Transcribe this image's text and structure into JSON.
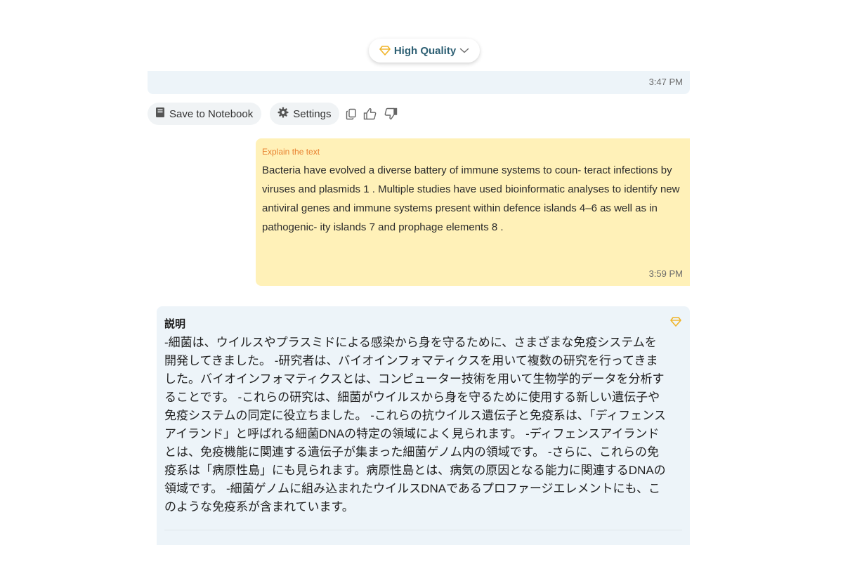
{
  "quality_selector": {
    "label": "High Quality"
  },
  "previous_message": {
    "time": "3:47 PM"
  },
  "actions": {
    "save_label": "Save to Notebook",
    "settings_label": "Settings"
  },
  "user_message": {
    "label": "Explain the text",
    "text": "Bacteria have evolved a diverse battery of immune systems to coun- teract infections by viruses and plasmids 1 . Multiple studies have used bioinformatic analyses to identify new antiviral genes and immune systems present within defence islands 4–6 as well as in pathogenic- ity islands 7 and prophage elements 8 .",
    "time": "3:59 PM"
  },
  "answer": {
    "title": "説明",
    "text": "-細菌は、ウイルスやプラスミドによる感染から身を守るために、さまざまな免疫システムを開発してきました。 -研究者は、バイオインフォマティクスを用いて複数の研究を行ってきました。バイオインフォマティクスとは、コンピューター技術を用いて生物学的データを分析することです。 -これらの研究は、細菌がウイルスから身を守るために使用する新しい遺伝子や免疫システムの同定に役立ちました。 -これらの抗ウイルス遺伝子と免疫系は、「ディフェンスアイランド」と呼ばれる細菌DNAの特定の領域によく見られます。 -ディフェンスアイランドとは、免疫機能に関連する遺伝子が集まった細菌ゲノム内の領域です。 -さらに、これらの免疫系は「病原性島」にも見られます。病原性島とは、病気の原因となる能力に関連するDNAの領域です。 -細菌ゲノムに組み込まれたウイルスDNAであるプロファージエレメントにも、このような免疫系が含まれています。"
  },
  "colors": {
    "gem": "#f0b429",
    "message_bg": "#edf4f9",
    "user_bg": "#fff1b8",
    "label_orange": "#e8812f",
    "pill_text": "#2d5f73"
  },
  "icons": {
    "quality": "diamond-icon",
    "chevron": "chevron-down-icon",
    "save": "notebook-icon",
    "settings": "gear-icon",
    "copy": "copy-icon",
    "like": "thumbs-up-icon",
    "dislike": "thumbs-down-icon",
    "answer_quality": "diamond-icon"
  }
}
